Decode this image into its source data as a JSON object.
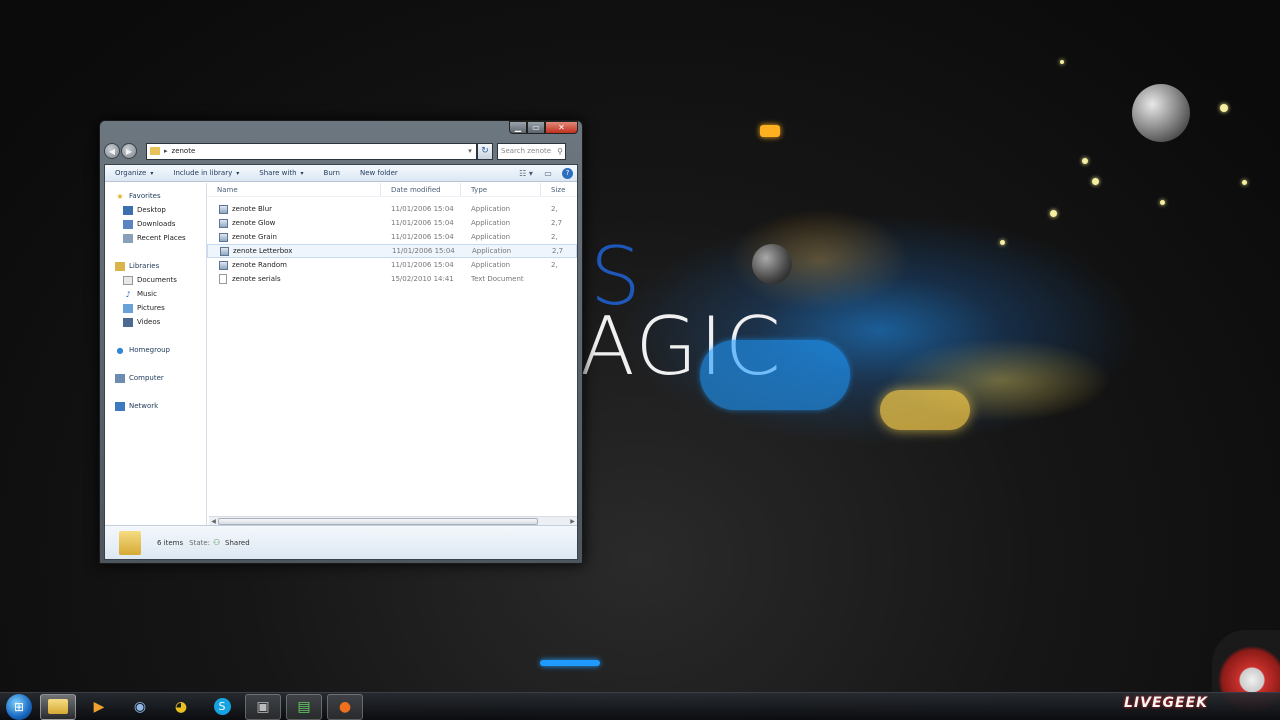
{
  "desktop": {
    "wallpaper_text_1": "S",
    "wallpaper_text_2": "AGIC"
  },
  "window": {
    "address": {
      "crumb": "zenote"
    },
    "search": {
      "placeholder": "Search zenote"
    },
    "toolbar": {
      "organize": "Organize",
      "include_in_library": "Include in library",
      "share_with": "Share with",
      "burn": "Burn",
      "new_folder": "New folder"
    },
    "nav": {
      "favorites": "Favorites",
      "desktop": "Desktop",
      "downloads": "Downloads",
      "recent_places": "Recent Places",
      "libraries": "Libraries",
      "documents": "Documents",
      "music": "Music",
      "pictures": "Pictures",
      "videos": "Videos",
      "homegroup": "Homegroup",
      "computer": "Computer",
      "network": "Network"
    },
    "columns": {
      "name": "Name",
      "date_modified": "Date modified",
      "type": "Type",
      "size": "Size"
    },
    "files": [
      {
        "name": "zenote Blur",
        "date": "11/01/2006 15:04",
        "type": "Application",
        "size": "2,"
      },
      {
        "name": "zenote Glow",
        "date": "11/01/2006 15:04",
        "type": "Application",
        "size": "2,7"
      },
      {
        "name": "zenote Grain",
        "date": "11/01/2006 15:04",
        "type": "Application",
        "size": "2,"
      },
      {
        "name": "zenote Letterbox",
        "date": "11/01/2006 15:04",
        "type": "Application",
        "size": "2,7"
      },
      {
        "name": "zenote Random",
        "date": "11/01/2006 15:04",
        "type": "Application",
        "size": "2,"
      },
      {
        "name": "zenote serials",
        "date": "15/02/2010 14:41",
        "type": "Text Document",
        "size": ""
      }
    ],
    "details": {
      "count": "6 items",
      "state_label": "State:",
      "state_value": "Shared"
    }
  },
  "taskbar": {
    "brand": "LIVEGEEK",
    "apps": [
      "explorer",
      "media-player",
      "chrome-like-browser",
      "chrome",
      "skype",
      "camera",
      "app",
      "firefox"
    ]
  }
}
